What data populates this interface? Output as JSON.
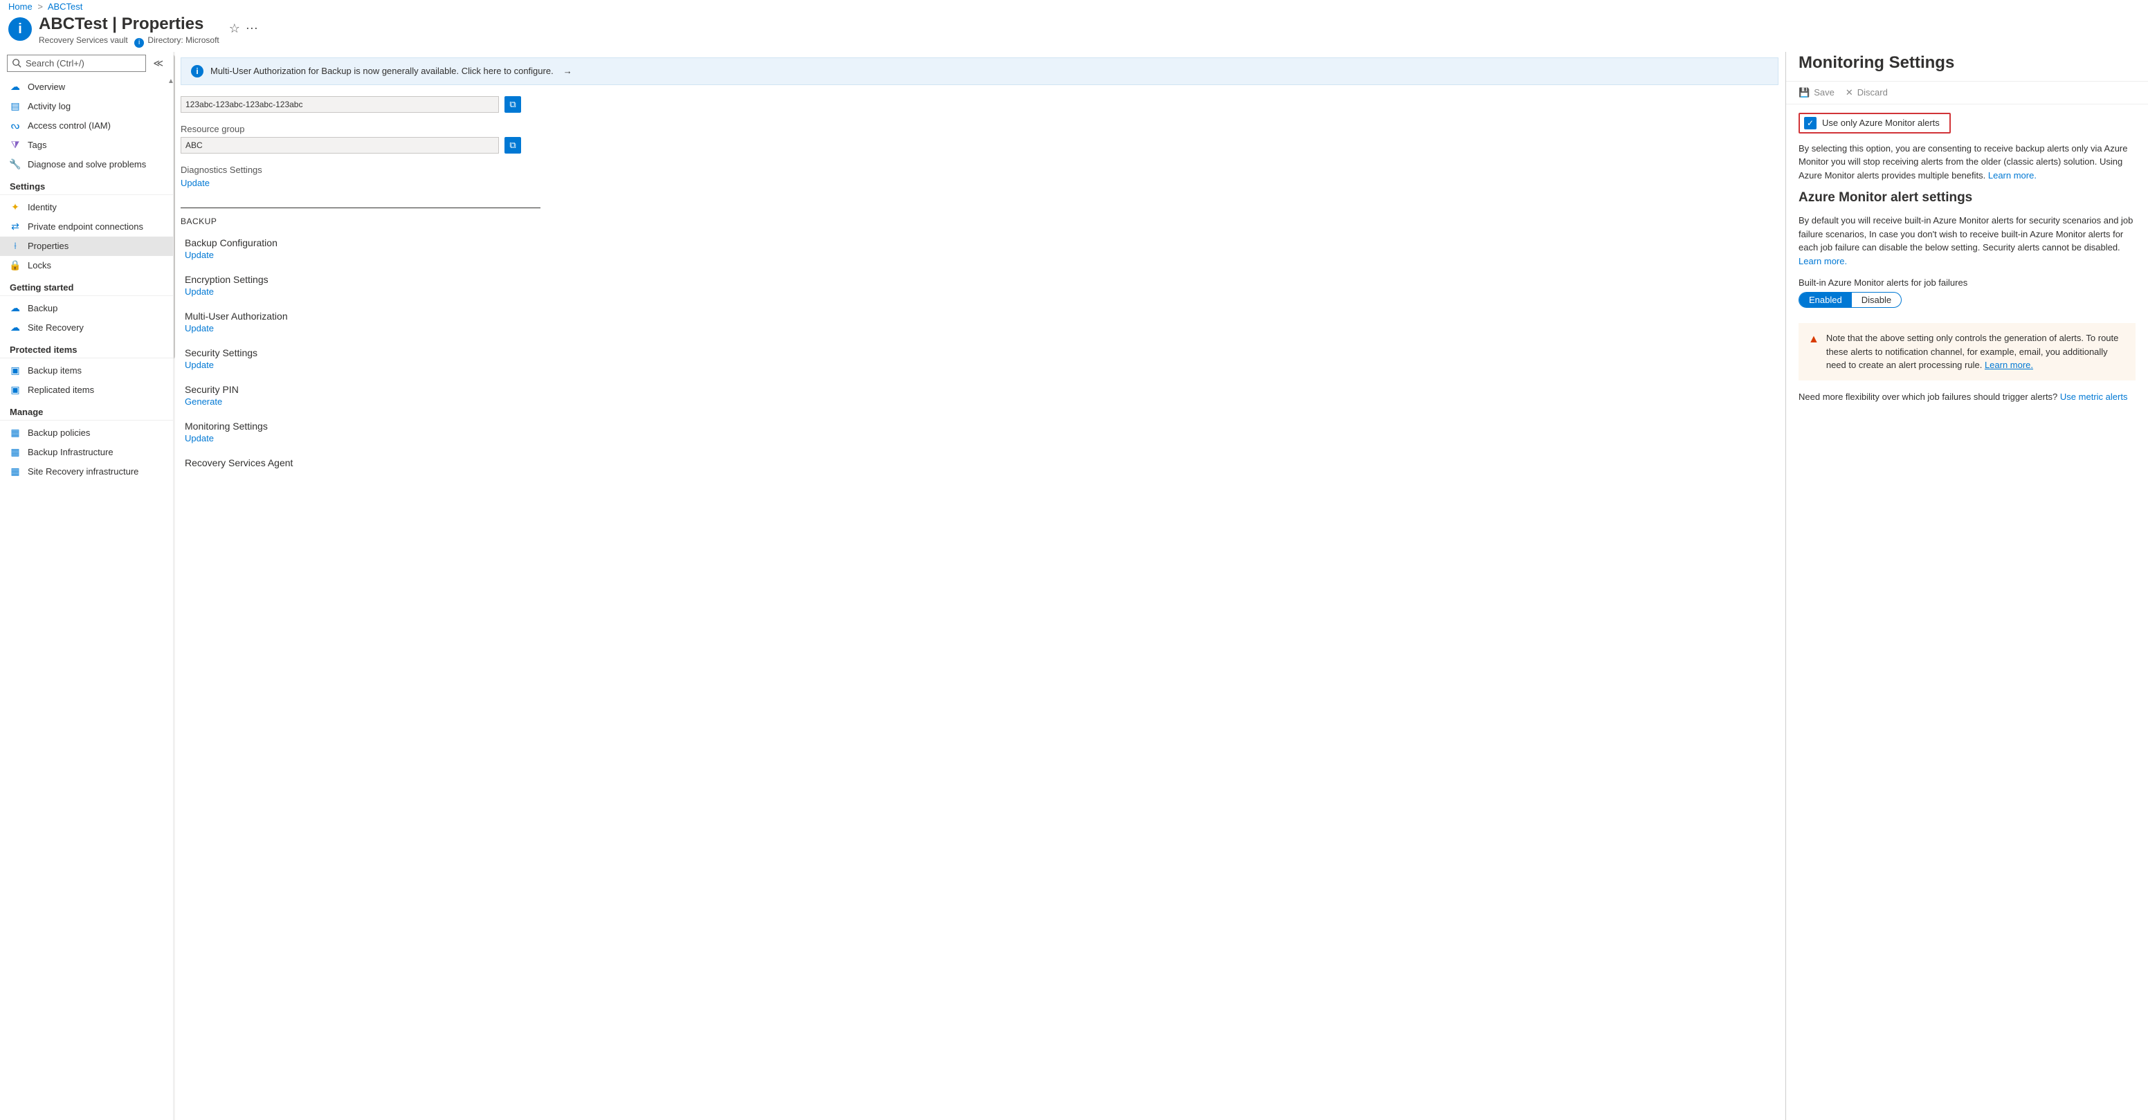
{
  "breadcrumb": {
    "home": "Home",
    "resource": "ABCTest"
  },
  "header": {
    "title": "ABCTest | Properties",
    "subtitle": "Recovery Services vault",
    "directory_label": "Directory: Microsoft"
  },
  "search": {
    "placeholder": "Search (Ctrl+/)"
  },
  "nav": {
    "top": [
      {
        "label": "Overview",
        "icon": "overview"
      },
      {
        "label": "Activity log",
        "icon": "activity"
      },
      {
        "label": "Access control (IAM)",
        "icon": "iam"
      },
      {
        "label": "Tags",
        "icon": "tags"
      },
      {
        "label": "Diagnose and solve problems",
        "icon": "diagnose"
      }
    ],
    "sections": [
      {
        "title": "Settings",
        "items": [
          {
            "label": "Identity",
            "icon": "identity"
          },
          {
            "label": "Private endpoint connections",
            "icon": "endpoint"
          },
          {
            "label": "Properties",
            "icon": "properties",
            "selected": true
          },
          {
            "label": "Locks",
            "icon": "locks"
          }
        ]
      },
      {
        "title": "Getting started",
        "items": [
          {
            "label": "Backup",
            "icon": "backup"
          },
          {
            "label": "Site Recovery",
            "icon": "siterecovery"
          }
        ]
      },
      {
        "title": "Protected items",
        "items": [
          {
            "label": "Backup items",
            "icon": "backupitems"
          },
          {
            "label": "Replicated items",
            "icon": "replicated"
          }
        ]
      },
      {
        "title": "Manage",
        "items": [
          {
            "label": "Backup policies",
            "icon": "policies"
          },
          {
            "label": "Backup Infrastructure",
            "icon": "infra"
          },
          {
            "label": "Site Recovery infrastructure",
            "icon": "srinfra"
          }
        ]
      }
    ]
  },
  "main": {
    "banner": "Multi-User Authorization for Backup is now generally available. Click here to configure.",
    "id_value": "123abc-123abc-123abc-123abc",
    "rg_label": "Resource group",
    "rg_value": "ABC",
    "diag_label": "Diagnostics Settings",
    "update": "Update",
    "generate": "Generate",
    "backup_head": "BACKUP",
    "blocks": [
      {
        "title": "Backup Configuration",
        "link": "Update"
      },
      {
        "title": "Encryption Settings",
        "link": "Update"
      },
      {
        "title": "Multi-User Authorization",
        "link": "Update"
      },
      {
        "title": "Security Settings",
        "link": "Update"
      },
      {
        "title": "Security PIN",
        "link": "Generate"
      },
      {
        "title": "Monitoring Settings",
        "link": "Update"
      },
      {
        "title": "Recovery Services Agent",
        "link": ""
      }
    ]
  },
  "panel": {
    "title": "Monitoring Settings",
    "save": "Save",
    "discard": "Discard",
    "checkbox_label": "Use only Azure Monitor alerts",
    "desc1": "By selecting this option, you are consenting to receive backup alerts only via Azure Monitor you will stop receiving alerts from the older (classic alerts) solution. Using Azure Monitor alerts provides multiple benefits.",
    "learn_more": "Learn more.",
    "h3": "Azure Monitor alert settings",
    "desc2": "By default you will receive built-in Azure Monitor alerts for security scenarios and job failure scenarios, In case you don't wish to receive built-in Azure Monitor alerts for each job failure can disable the below setting. Security alerts cannot be disabled.",
    "toggle_label": "Built-in Azure Monitor alerts for job failures",
    "toggle_on": "Enabled",
    "toggle_off": "Disable",
    "callout": "Note that the above setting only controls the generation of alerts. To route these alerts to notification channel, for example, email, you additionally need to create an alert processing rule.",
    "flex_text": "Need more flexibility over which job failures should trigger alerts?",
    "flex_link": "Use metric alerts"
  }
}
